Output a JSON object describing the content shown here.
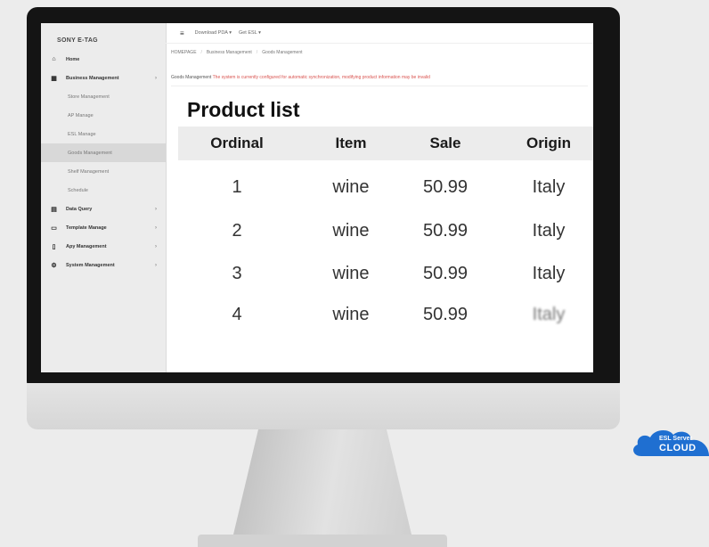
{
  "sidebar": {
    "brand": "SONY E-TAG",
    "items": [
      {
        "label": "Home",
        "icon": "home-icon"
      },
      {
        "label": "Business Management",
        "icon": "grid-icon",
        "chevron": "›"
      },
      {
        "label": "Store Management"
      },
      {
        "label": "AP Manage"
      },
      {
        "label": "ESL Manage"
      },
      {
        "label": "Goods Management"
      },
      {
        "label": "Shelf Management"
      },
      {
        "label": "Schedule"
      },
      {
        "label": "Data Query",
        "icon": "database-icon",
        "chevron": "›"
      },
      {
        "label": "Template Manage",
        "icon": "template-icon",
        "chevron": "›"
      },
      {
        "label": "Apy Management",
        "icon": "device-icon",
        "chevron": "›"
      },
      {
        "label": "System Management",
        "icon": "settings-icon",
        "chevron": "›"
      }
    ]
  },
  "topbar": {
    "menu_label": "Download PDA ▾",
    "esl_label": "Get ESL ▾"
  },
  "breadcrumb": {
    "home": "HOMEPAGE",
    "section": "Business Management",
    "page": "Goods Management"
  },
  "notice": {
    "prefix": "Goods Management",
    "warning": "The system is currently configured for automatic synchronization, modifying product information may be invalid"
  },
  "product_list": {
    "title": "Product list",
    "columns": [
      "Ordinal",
      "Item",
      "Sale",
      "Origin"
    ],
    "rows": [
      [
        "1",
        "wine",
        "50.99",
        "Italy"
      ],
      [
        "2",
        "wine",
        "50.99",
        "Italy"
      ],
      [
        "3",
        "wine",
        "50.99",
        "Italy"
      ],
      [
        "4",
        "wine",
        "50.99",
        "Italy"
      ]
    ]
  },
  "cloud_badge": {
    "line1": "ESL Server",
    "line2": "CLOUD",
    "color": "#1f6fd1"
  }
}
